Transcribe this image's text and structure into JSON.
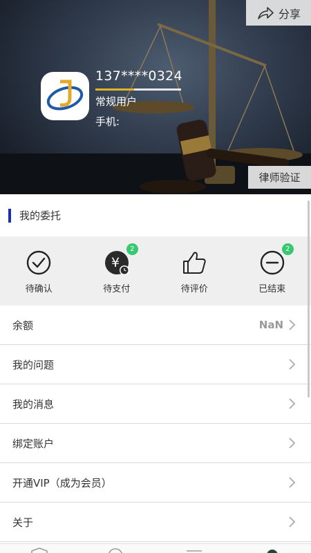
{
  "header": {
    "share_label": "分享",
    "user_name": "137****0324",
    "user_type": "常规用户",
    "phone_label": "手机:",
    "level_progress": 0.45,
    "lawyer_verify_label": "律师验证"
  },
  "section": {
    "title": "我的委托"
  },
  "orders": [
    {
      "label": "待确认",
      "icon": "check-circle-icon",
      "badge": ""
    },
    {
      "label": "待支付",
      "icon": "yuan-clock-icon",
      "badge": "2"
    },
    {
      "label": "待评价",
      "icon": "thumbs-up-icon",
      "badge": ""
    },
    {
      "label": "已结束",
      "icon": "minus-circle-icon",
      "badge": "2"
    }
  ],
  "menu": [
    {
      "label": "余额",
      "value": "NaN"
    },
    {
      "label": "我的问题",
      "value": ""
    },
    {
      "label": "我的消息",
      "value": ""
    },
    {
      "label": "绑定账户",
      "value": ""
    },
    {
      "label": "开通VIP（成为会员）",
      "value": ""
    },
    {
      "label": "关于",
      "value": ""
    }
  ],
  "colors": {
    "accent_bar": "#1a2fa8",
    "badge": "#37c870",
    "level_fill": "#e3b427"
  }
}
